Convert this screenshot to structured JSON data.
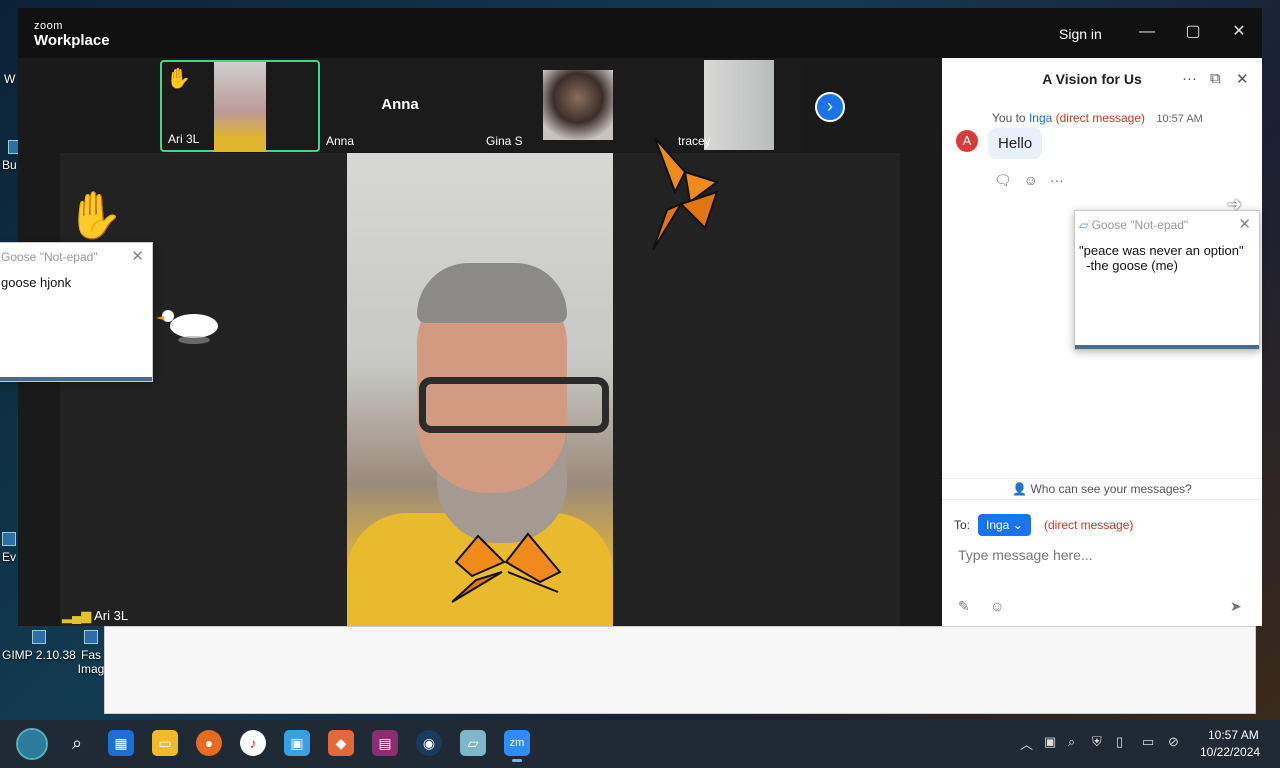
{
  "desktop": {
    "icons": [
      {
        "label": "GIMP 2.10.38"
      },
      {
        "label": "Fas Imag"
      },
      {
        "label": "W"
      },
      {
        "label": "Bu D"
      },
      {
        "label": "Ev"
      }
    ]
  },
  "window": {
    "logo_small": "zoom",
    "logo_big": "Workplace",
    "sign_in": "Sign in",
    "minimize": "—",
    "maximize": "▢",
    "close": "✕"
  },
  "participants": [
    {
      "name": "Ari 3L",
      "hand_raised": true,
      "active": true
    },
    {
      "name": "Anna",
      "display": "Anna"
    },
    {
      "name": "Gina S"
    },
    {
      "name": "tracey"
    }
  ],
  "stage": {
    "speaker_name": "Ari 3L",
    "raise_hand_emoji": "✋"
  },
  "notepad_left": {
    "title": "Goose \"Not-epad\"",
    "text": "goose hjonk"
  },
  "notepad_right": {
    "title": "Goose \"Not-epad\"",
    "line1": "\"peace was never an option\"",
    "line2": "  -the goose (me)"
  },
  "chat": {
    "title": "A Vision for Us",
    "message": {
      "from": "You to",
      "to": "Inga",
      "type": "(direct message)",
      "time": "10:57 AM",
      "avatar": "A",
      "text": "Hello"
    },
    "who_can_see": "Who can see your messages?",
    "to_label": "To:",
    "recipient": "Inga",
    "recipient_type": "(direct message)",
    "input_placeholder": "Type message here..."
  },
  "taskbar": {
    "time": "10:57 AM",
    "date": "10/22/2024",
    "apps": [
      "start",
      "search",
      "task-view",
      "file-explorer",
      "firefox",
      "itunes",
      "store",
      "app",
      "winrar",
      "steam",
      "notepad",
      "zoom"
    ]
  }
}
